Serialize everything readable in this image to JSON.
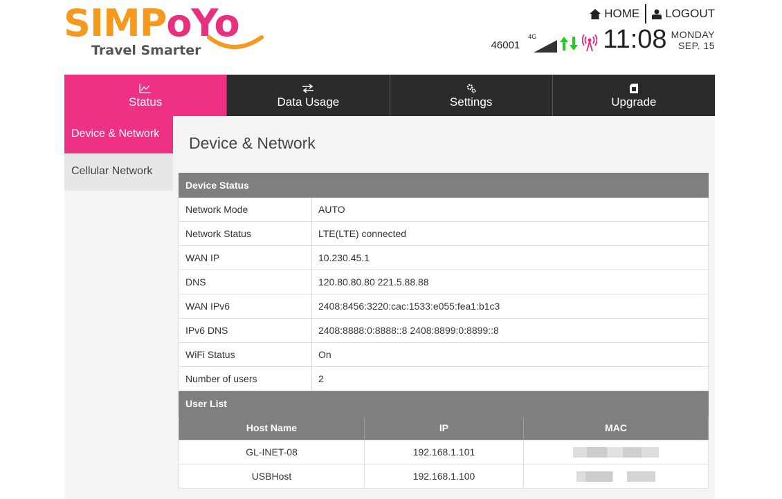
{
  "brand": {
    "name_part1": "SIMP",
    "name_part2": "oYo",
    "tagline": "Travel Smarter",
    "colors": {
      "orange": "#f59a1e",
      "pink": "#e8307e"
    }
  },
  "top_links": {
    "home": {
      "label": "HOME",
      "icon": "home-icon"
    },
    "logout": {
      "label": "LOGOUT",
      "icon": "user-icon"
    }
  },
  "status_bar": {
    "carrier": "46001",
    "network_type": "4G",
    "signal_icon": "signal-strength-icon",
    "data_icon": "up-down-arrows-icon",
    "wifi_icon": "broadcast-antenna-icon",
    "time": "11:08",
    "day": "MONDAY",
    "date": "SEP. 15"
  },
  "tabs": [
    {
      "label": "Status",
      "icon": "chart-icon",
      "active": true
    },
    {
      "label": "Data Usage",
      "icon": "transfer-arrows-icon",
      "active": false
    },
    {
      "label": "Settings",
      "icon": "gears-icon",
      "active": false
    },
    {
      "label": "Upgrade",
      "icon": "sim-card-icon",
      "active": false
    }
  ],
  "sidebar": {
    "items": [
      {
        "label": "Device & Network",
        "active": true
      },
      {
        "label": "Cellular Network",
        "active": false
      }
    ]
  },
  "page": {
    "title": "Device & Network"
  },
  "device_status": {
    "heading": "Device Status",
    "rows": [
      {
        "label": "Network Mode",
        "value": "AUTO"
      },
      {
        "label": "Network Status",
        "value": "LTE(LTE) connected"
      },
      {
        "label": "WAN IP",
        "value": "10.230.45.1"
      },
      {
        "label": "DNS",
        "value": "120.80.80.80 221.5.88.88"
      },
      {
        "label": "WAN IPv6",
        "value": "2408:8456:3220:cac:1533:e055:fea1:b1c3"
      },
      {
        "label": "IPv6 DNS",
        "value": "2408:8888:0:8888::8 2408:8899:0:8899::8"
      },
      {
        "label": "WiFi Status",
        "value": "On"
      },
      {
        "label": "Number of users",
        "value": "2"
      }
    ]
  },
  "user_list": {
    "heading": "User List",
    "columns": [
      "Host Name",
      "IP",
      "MAC"
    ],
    "rows": [
      {
        "host": "GL-INET-08",
        "ip": "192.168.1.101"
      },
      {
        "host": "USBHost",
        "ip": "192.168.1.100"
      }
    ]
  },
  "theme": {
    "accent": "#ee3184",
    "nav_dark": "#2b2b2b",
    "table_head": "#7f7f7f"
  }
}
